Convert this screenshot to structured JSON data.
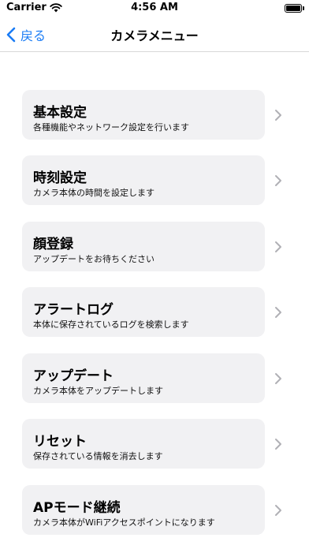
{
  "status_bar": {
    "carrier": "Carrier",
    "time": "4:56 AM",
    "icons": [
      "wifi-icon",
      "battery-icon"
    ]
  },
  "nav": {
    "back_label": "戻る",
    "title": "カメラメニュー",
    "accent_color": "#1a7cf5"
  },
  "menu": {
    "items": [
      {
        "title": "基本設定",
        "subtitle": "各種機能やネットワーク設定を行います"
      },
      {
        "title": "時刻設定",
        "subtitle": "カメラ本体の時間を設定します"
      },
      {
        "title": "顔登録",
        "subtitle": "アップデートをお待ちください"
      },
      {
        "title": "アラートログ",
        "subtitle": "本体に保存されているログを検索します"
      },
      {
        "title": "アップデート",
        "subtitle": "カメラ本体をアップデートします"
      },
      {
        "title": "リセット",
        "subtitle": "保存されている情報を消去します"
      },
      {
        "title": "APモード継続",
        "subtitle": "カメラ本体がWiFiアクセスポイントになります"
      }
    ]
  }
}
